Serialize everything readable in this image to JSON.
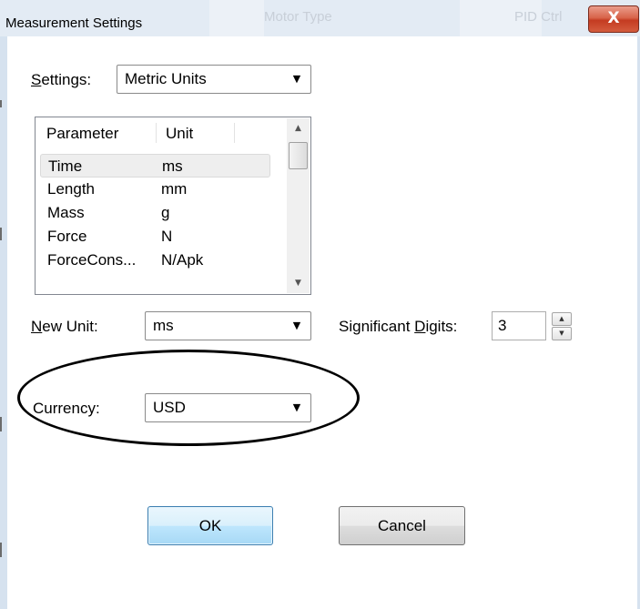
{
  "window": {
    "title": "Measurement Settings",
    "background_ghost_titles": [
      "Motor Type",
      "PID Ctrl"
    ],
    "close_glyph": "X"
  },
  "settings": {
    "label_mnemonic": "S",
    "label_rest": "ettings:",
    "value": "Metric Units"
  },
  "parameter_table": {
    "columns": [
      "Parameter",
      "Unit"
    ],
    "rows": [
      {
        "parameter": "Time",
        "unit": "ms",
        "selected": true
      },
      {
        "parameter": "Length",
        "unit": "mm",
        "selected": false
      },
      {
        "parameter": "Mass",
        "unit": "g",
        "selected": false
      },
      {
        "parameter": "Force",
        "unit": "N",
        "selected": false
      },
      {
        "parameter": "ForceCons...",
        "unit": "N/Apk",
        "selected": false
      }
    ],
    "scroll_up_icon": "▲",
    "scroll_down_icon": "▼"
  },
  "new_unit": {
    "label_mnemonic": "N",
    "label_rest": "ew Unit:",
    "value": "ms"
  },
  "significant_digits": {
    "label_before": "Significant ",
    "label_mnemonic": "D",
    "label_after": "igits:",
    "value": "3",
    "up_icon": "▲",
    "down_icon": "▼"
  },
  "currency": {
    "label": "Currency:",
    "value": "USD"
  },
  "buttons": {
    "ok": "OK",
    "cancel": "Cancel"
  },
  "icons": {
    "dropdown_arrow": "▼"
  },
  "colors": {
    "title_bar": "#e3ebf4",
    "close_button": "#c43b21",
    "ok_button_border": "#3c7fb1",
    "selected_row": "#eeeeee"
  }
}
